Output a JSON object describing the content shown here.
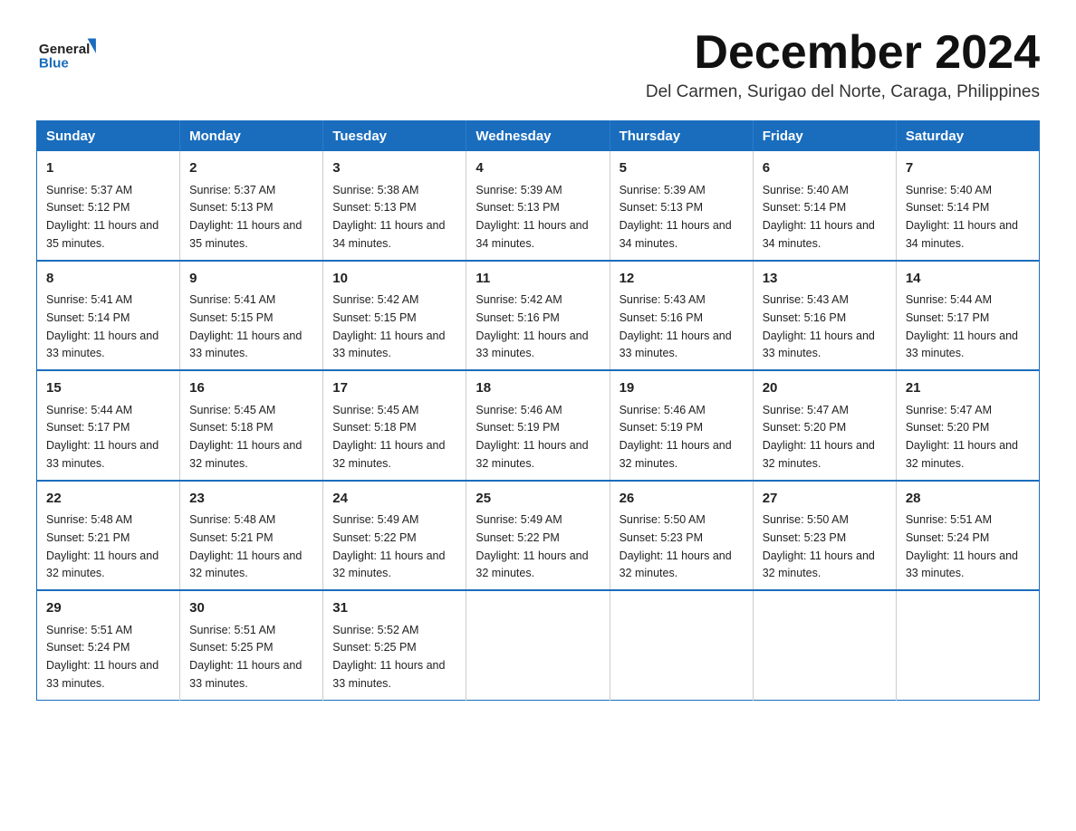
{
  "header": {
    "logo_general": "General",
    "logo_blue": "Blue",
    "month_title": "December 2024",
    "location": "Del Carmen, Surigao del Norte, Caraga, Philippines"
  },
  "weekdays": [
    "Sunday",
    "Monday",
    "Tuesday",
    "Wednesday",
    "Thursday",
    "Friday",
    "Saturday"
  ],
  "weeks": [
    [
      {
        "day": "1",
        "sunrise": "5:37 AM",
        "sunset": "5:12 PM",
        "daylight": "11 hours and 35 minutes."
      },
      {
        "day": "2",
        "sunrise": "5:37 AM",
        "sunset": "5:13 PM",
        "daylight": "11 hours and 35 minutes."
      },
      {
        "day": "3",
        "sunrise": "5:38 AM",
        "sunset": "5:13 PM",
        "daylight": "11 hours and 34 minutes."
      },
      {
        "day": "4",
        "sunrise": "5:39 AM",
        "sunset": "5:13 PM",
        "daylight": "11 hours and 34 minutes."
      },
      {
        "day": "5",
        "sunrise": "5:39 AM",
        "sunset": "5:13 PM",
        "daylight": "11 hours and 34 minutes."
      },
      {
        "day": "6",
        "sunrise": "5:40 AM",
        "sunset": "5:14 PM",
        "daylight": "11 hours and 34 minutes."
      },
      {
        "day": "7",
        "sunrise": "5:40 AM",
        "sunset": "5:14 PM",
        "daylight": "11 hours and 34 minutes."
      }
    ],
    [
      {
        "day": "8",
        "sunrise": "5:41 AM",
        "sunset": "5:14 PM",
        "daylight": "11 hours and 33 minutes."
      },
      {
        "day": "9",
        "sunrise": "5:41 AM",
        "sunset": "5:15 PM",
        "daylight": "11 hours and 33 minutes."
      },
      {
        "day": "10",
        "sunrise": "5:42 AM",
        "sunset": "5:15 PM",
        "daylight": "11 hours and 33 minutes."
      },
      {
        "day": "11",
        "sunrise": "5:42 AM",
        "sunset": "5:16 PM",
        "daylight": "11 hours and 33 minutes."
      },
      {
        "day": "12",
        "sunrise": "5:43 AM",
        "sunset": "5:16 PM",
        "daylight": "11 hours and 33 minutes."
      },
      {
        "day": "13",
        "sunrise": "5:43 AM",
        "sunset": "5:16 PM",
        "daylight": "11 hours and 33 minutes."
      },
      {
        "day": "14",
        "sunrise": "5:44 AM",
        "sunset": "5:17 PM",
        "daylight": "11 hours and 33 minutes."
      }
    ],
    [
      {
        "day": "15",
        "sunrise": "5:44 AM",
        "sunset": "5:17 PM",
        "daylight": "11 hours and 33 minutes."
      },
      {
        "day": "16",
        "sunrise": "5:45 AM",
        "sunset": "5:18 PM",
        "daylight": "11 hours and 32 minutes."
      },
      {
        "day": "17",
        "sunrise": "5:45 AM",
        "sunset": "5:18 PM",
        "daylight": "11 hours and 32 minutes."
      },
      {
        "day": "18",
        "sunrise": "5:46 AM",
        "sunset": "5:19 PM",
        "daylight": "11 hours and 32 minutes."
      },
      {
        "day": "19",
        "sunrise": "5:46 AM",
        "sunset": "5:19 PM",
        "daylight": "11 hours and 32 minutes."
      },
      {
        "day": "20",
        "sunrise": "5:47 AM",
        "sunset": "5:20 PM",
        "daylight": "11 hours and 32 minutes."
      },
      {
        "day": "21",
        "sunrise": "5:47 AM",
        "sunset": "5:20 PM",
        "daylight": "11 hours and 32 minutes."
      }
    ],
    [
      {
        "day": "22",
        "sunrise": "5:48 AM",
        "sunset": "5:21 PM",
        "daylight": "11 hours and 32 minutes."
      },
      {
        "day": "23",
        "sunrise": "5:48 AM",
        "sunset": "5:21 PM",
        "daylight": "11 hours and 32 minutes."
      },
      {
        "day": "24",
        "sunrise": "5:49 AM",
        "sunset": "5:22 PM",
        "daylight": "11 hours and 32 minutes."
      },
      {
        "day": "25",
        "sunrise": "5:49 AM",
        "sunset": "5:22 PM",
        "daylight": "11 hours and 32 minutes."
      },
      {
        "day": "26",
        "sunrise": "5:50 AM",
        "sunset": "5:23 PM",
        "daylight": "11 hours and 32 minutes."
      },
      {
        "day": "27",
        "sunrise": "5:50 AM",
        "sunset": "5:23 PM",
        "daylight": "11 hours and 32 minutes."
      },
      {
        "day": "28",
        "sunrise": "5:51 AM",
        "sunset": "5:24 PM",
        "daylight": "11 hours and 33 minutes."
      }
    ],
    [
      {
        "day": "29",
        "sunrise": "5:51 AM",
        "sunset": "5:24 PM",
        "daylight": "11 hours and 33 minutes."
      },
      {
        "day": "30",
        "sunrise": "5:51 AM",
        "sunset": "5:25 PM",
        "daylight": "11 hours and 33 minutes."
      },
      {
        "day": "31",
        "sunrise": "5:52 AM",
        "sunset": "5:25 PM",
        "daylight": "11 hours and 33 minutes."
      },
      null,
      null,
      null,
      null
    ]
  ]
}
